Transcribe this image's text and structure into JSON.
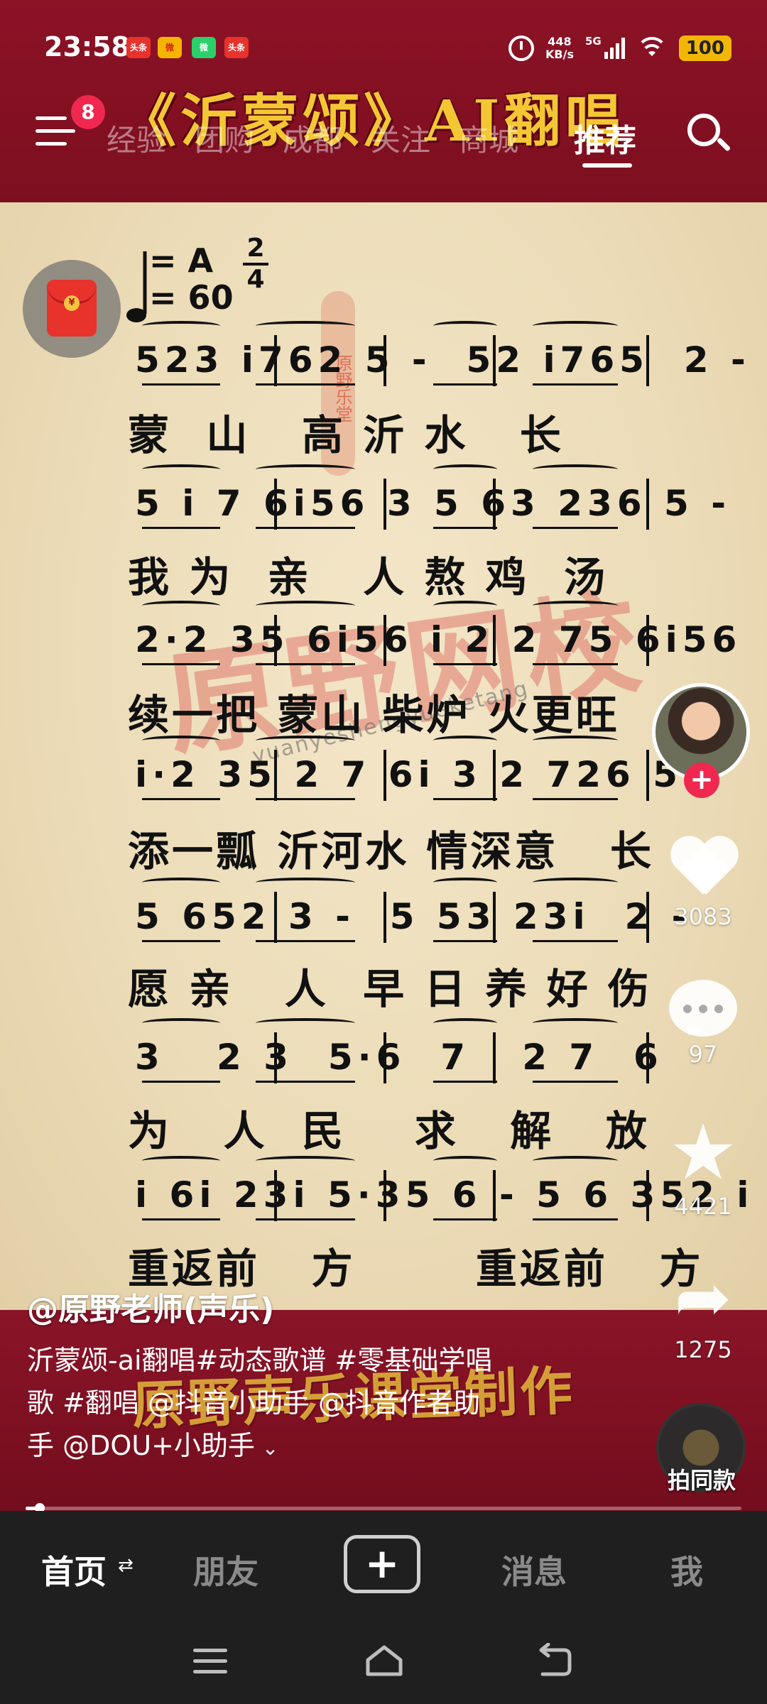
{
  "status_bar": {
    "time": "23:58",
    "notifications": [
      {
        "name": "toutiao-icon",
        "label": "头条",
        "bg": "#e8322c",
        "fg": "#ffffff"
      },
      {
        "name": "weibo-icon",
        "label": "微",
        "bg": "#f4b400",
        "fg": "#d9221b"
      },
      {
        "name": "wechat-icon",
        "label": "微",
        "bg": "#2bd06a",
        "fg": "#ffffff"
      },
      {
        "name": "toutiao-icon",
        "label": "头条",
        "bg": "#e8322c",
        "fg": "#ffffff"
      }
    ],
    "net_speed_value": "448",
    "net_speed_unit": "KB/s",
    "signal_label": "5G",
    "battery": "100"
  },
  "top_nav": {
    "menu_badge": "8",
    "tabs": [
      "经验",
      "团购",
      "成都",
      "关注",
      "商城"
    ],
    "active_tab": "推荐"
  },
  "video": {
    "overlay_title": "《沂蒙颂》AI翻唱",
    "tempo_key": "= A",
    "tempo_bpm": "= 60",
    "time_sig_top": "2",
    "time_sig_bottom": "4",
    "stamp": "原野乐堂",
    "watermark": "原野网校",
    "watermark_site": "yuanyeshengyueketang",
    "overlay_credit": "原野声乐课堂制作",
    "score_lines": [
      {
        "numbers": "523 i762 5 -  52 i765  2 -",
        "lyrics": "蒙  山   高 沂 水   长"
      },
      {
        "numbers": "5 i 7 6i56 3 5 63 236 5 -",
        "lyrics": "我 为  亲   人 熬 鸡  汤"
      },
      {
        "numbers": "2·2 35 6i56 i 2 2 75 6i56",
        "lyrics": "续一把 蒙山 柴炉 火更旺"
      },
      {
        "numbers": "i·2 35 2 7 6i 3 2 726 5 -",
        "lyrics": "添一瓢 沂河水 情深意   长"
      },
      {
        "numbers": "5 652 3 -  5 53 23i  2 -",
        "lyrics": "愿 亲   人  早 日 养 好 伤"
      },
      {
        "numbers": "3   2 3  5·6  7   2 7  6",
        "lyrics": "为   人  民    求   解   放"
      },
      {
        "numbers": "i 6i 23i 5·35 6 - 5 6 352 i -",
        "lyrics": "重返前   方       重返前   方"
      }
    ]
  },
  "actions": {
    "likes": "3083",
    "comments": "97",
    "favorites": "4421",
    "shares": "1275",
    "duet_label": "拍同款"
  },
  "caption": {
    "author": "@原野老师(声乐)",
    "text_line1": "沂蒙颂-ai翻唱#动态歌谱 #零基础学唱",
    "text_line2": "歌  #翻唱 @抖音小助手 @抖音作者助",
    "text_line3": "手 @DOU+小助手",
    "expand_icon": "⌄"
  },
  "playback": {
    "progress": 0.02
  },
  "tab_bar": {
    "home": "首页",
    "home_swap": "⇄",
    "friends": "朋友",
    "create": "+",
    "inbox": "消息",
    "me": "我"
  },
  "colors": {
    "brand_red": "#8c1226",
    "badge_pink": "#f0284f",
    "title_gold": "#f3c734",
    "parchment": "#efe1c2"
  }
}
